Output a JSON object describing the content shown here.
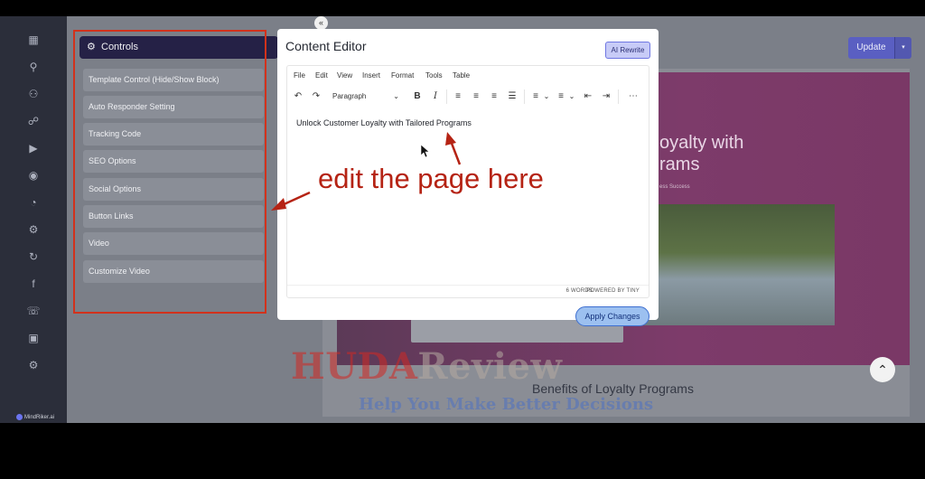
{
  "sidebar": {
    "brand": "MindRiker.ai",
    "icons": [
      "grid-icon",
      "search-icon",
      "users-icon",
      "link-icon",
      "play-icon",
      "play-circle-icon",
      "pie-chart-icon",
      "settings-icon",
      "refresh-icon",
      "facebook-icon",
      "headset-icon",
      "gift-icon",
      "gear-icon"
    ]
  },
  "controls": {
    "title": "Controls",
    "items": [
      {
        "label": "Template Control (Hide/Show Block)"
      },
      {
        "label": "Auto Responder Setting"
      },
      {
        "label": "Tracking Code"
      },
      {
        "label": "SEO Options"
      },
      {
        "label": "Social Options"
      },
      {
        "label": "Button Links"
      },
      {
        "label": "Video"
      },
      {
        "label": "Customize Video"
      }
    ]
  },
  "annotation": {
    "text": "edit the page here"
  },
  "editor": {
    "title": "Content Editor",
    "ai_rewrite": "AI Rewrite",
    "menu": [
      "File",
      "Edit",
      "View",
      "Insert",
      "Format",
      "Tools",
      "Table"
    ],
    "block_format": "Paragraph",
    "content": "Unlock Customer Loyalty with Tailored Programs",
    "word_count": "6 WORDS",
    "powered_by": "POWERED BY TINY",
    "apply": "Apply Changes"
  },
  "page": {
    "update": "Update",
    "hero_title_line1": "oyalty with",
    "hero_title_line2": "rams",
    "hero_sub": "ess Success",
    "benefits": "Benefits of Loyalty Programs"
  },
  "watermark": {
    "part1": "HUDA",
    "part2": "Review",
    "tagline": "Help You Make Better Decisions"
  },
  "colors": {
    "accent": "#5a5fc2",
    "annotation": "#b52314",
    "controls_header": "#252146"
  }
}
